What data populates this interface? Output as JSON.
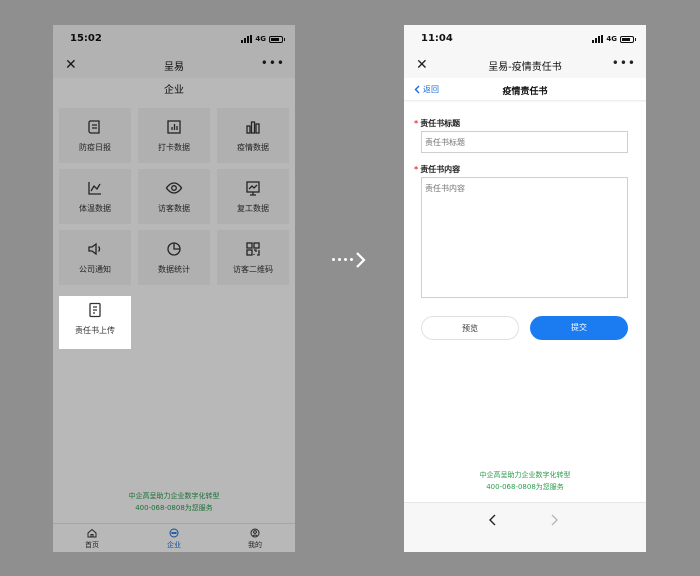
{
  "left_phone": {
    "status": {
      "time": "15:02",
      "network": "4G"
    },
    "nav": {
      "title": "呈易"
    },
    "page_title": "企业",
    "tiles": [
      {
        "label": "防疫日报",
        "icon": "scroll-icon"
      },
      {
        "label": "打卡数据",
        "icon": "bar-chart-box-icon"
      },
      {
        "label": "疫情数据",
        "icon": "bar-chart-icon"
      },
      {
        "label": "体温数据",
        "icon": "line-chart-icon"
      },
      {
        "label": "访客数据",
        "icon": "eye-icon"
      },
      {
        "label": "复工数据",
        "icon": "trend-board-icon"
      },
      {
        "label": "公司通知",
        "icon": "speaker-icon"
      },
      {
        "label": "数据统计",
        "icon": "pie-chart-icon"
      },
      {
        "label": "访客二维码",
        "icon": "qr-code-icon"
      },
      {
        "label": "责任书上传",
        "icon": "document-icon",
        "selected": true
      }
    ],
    "footer": {
      "line1": "中企高呈助力企业数字化转型",
      "line2": "400-068-0808为您服务"
    },
    "tabs": [
      {
        "label": "首页",
        "icon": "home-icon"
      },
      {
        "label": "企业",
        "icon": "chat-icon",
        "active": true
      },
      {
        "label": "我的",
        "icon": "user-icon"
      }
    ]
  },
  "right_phone": {
    "status": {
      "time": "11:04",
      "network": "4G"
    },
    "nav": {
      "title": "呈易-疫情责任书"
    },
    "sub_header": {
      "back_label": "返回",
      "title": "疫情责任书"
    },
    "form": {
      "title_label": "责任书标题",
      "title_placeholder": "责任书标题",
      "content_label": "责任书内容",
      "content_placeholder": "责任书内容",
      "required_mark": "*",
      "preview_button": "预览",
      "submit_button": "提交"
    },
    "footer": {
      "line1": "中企高呈助力企业数字化转型",
      "line2": "400-068-0808为您服务"
    }
  },
  "colors": {
    "accent": "#1a7cf0",
    "footer_green": "#2a9c4c",
    "required_red": "#e53935",
    "backdrop": "#8f8f8f"
  }
}
